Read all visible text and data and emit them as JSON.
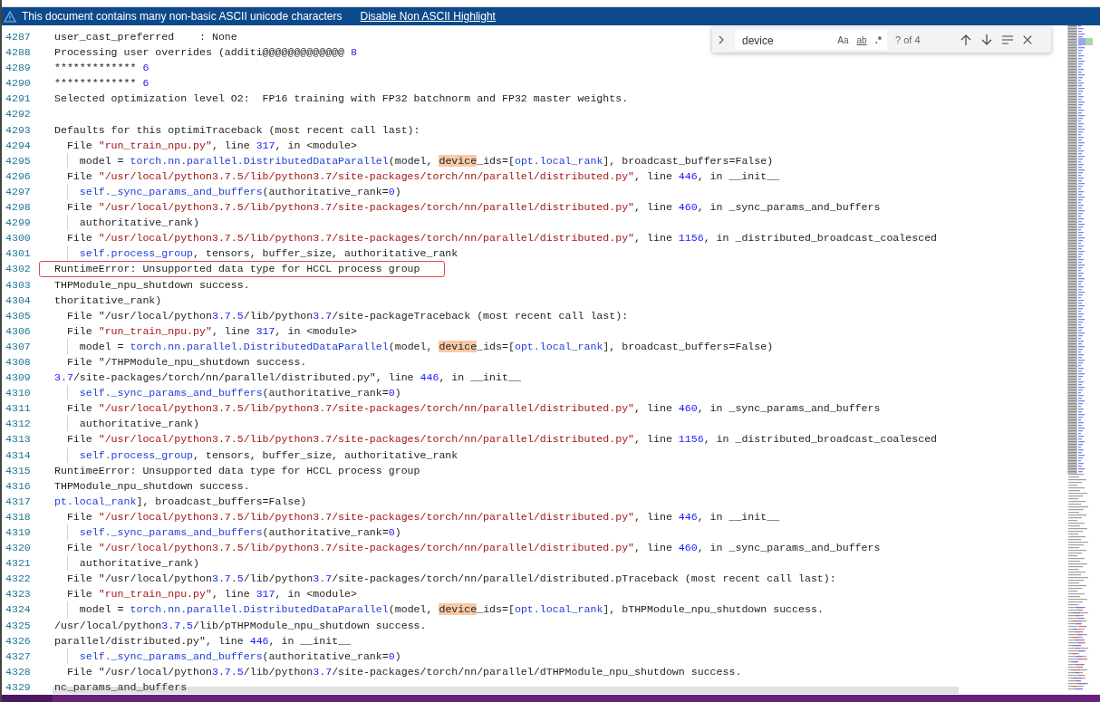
{
  "banner": {
    "message": "This document contains many non-basic ASCII unicode characters",
    "link": "Disable Non ASCII Highlight"
  },
  "find_widget": {
    "expanded": false,
    "query": "device",
    "options": [
      {
        "label": "Aa",
        "on": false
      },
      {
        "label": "ab",
        "on": false
      },
      {
        "label": ".*",
        "on": false
      }
    ],
    "match_count": "? of 4"
  },
  "lines": [
    {
      "number": "4287",
      "tokens": [
        {
          "kind": "text",
          "text": "user_cast_preferred    : None"
        }
      ]
    },
    {
      "number": "4288",
      "tokens": [
        {
          "kind": "text",
          "text": "Processing user overrides (additi@@@@@@@@@@@@@ "
        },
        {
          "kind": "number",
          "text": "8"
        }
      ]
    },
    {
      "number": "4289",
      "tokens": [
        {
          "kind": "text",
          "text": "************* "
        },
        {
          "kind": "number",
          "text": "6"
        }
      ]
    },
    {
      "number": "4290",
      "tokens": [
        {
          "kind": "text",
          "text": "************* "
        },
        {
          "kind": "number",
          "text": "6"
        }
      ]
    },
    {
      "number": "4291",
      "tokens": [
        {
          "kind": "text",
          "text": "Selected optimization level O2:  FP16 training with FP32 batchnorm and FP32 master weights."
        }
      ]
    },
    {
      "number": "4292"
    },
    {
      "number": "4293",
      "tokens": [
        {
          "kind": "text",
          "text": "Defaults for this optimiTraceback (most recent call last):"
        }
      ]
    },
    {
      "number": "4294",
      "tokens": [
        {
          "kind": "text",
          "text": "  File "
        },
        {
          "kind": "string",
          "text": "\"run_train_npu.py\""
        },
        {
          "kind": "text",
          "text": ", line "
        },
        {
          "kind": "number",
          "text": "317"
        },
        {
          "kind": "text",
          "text": ", in <module>"
        }
      ]
    },
    {
      "number": "4295",
      "tokens": [
        {
          "kind": "text",
          "text": "    model = "
        },
        {
          "kind": "name",
          "text": "torch.nn.parallel.DistributedDataParallel"
        },
        {
          "kind": "text",
          "text": "(model, "
        },
        {
          "kind": "match",
          "text": "device"
        },
        {
          "kind": "text",
          "text": "_ids=["
        },
        {
          "kind": "name",
          "text": "opt.local_rank"
        },
        {
          "kind": "text",
          "text": "], broadcast_buffers=False)"
        }
      ]
    },
    {
      "number": "4296",
      "tokens": [
        {
          "kind": "text",
          "text": "  File "
        },
        {
          "kind": "string",
          "text": "\"/usr/local/python3.7.5/lib/python3.7/site-packages/torch/nn/parallel/distributed.py\""
        },
        {
          "kind": "text",
          "text": ", line "
        },
        {
          "kind": "number",
          "text": "446"
        },
        {
          "kind": "text",
          "text": ", in __init__"
        }
      ]
    },
    {
      "number": "4297",
      "tokens": [
        {
          "kind": "name",
          "text": "    self._sync_params_and_buffers"
        },
        {
          "kind": "text",
          "text": "(authoritative_rank="
        },
        {
          "kind": "number",
          "text": "0"
        },
        {
          "kind": "text",
          "text": ")"
        }
      ]
    },
    {
      "number": "4298",
      "tokens": [
        {
          "kind": "text",
          "text": "  File "
        },
        {
          "kind": "string",
          "text": "\"/usr/local/python3.7.5/lib/python3.7/site-packages/torch/nn/parallel/distributed.py\""
        },
        {
          "kind": "text",
          "text": ", line "
        },
        {
          "kind": "number",
          "text": "460"
        },
        {
          "kind": "text",
          "text": ", in _sync_params_and_buffers"
        }
      ]
    },
    {
      "number": "4299",
      "tokens": [
        {
          "kind": "text",
          "text": "    authoritative_rank)"
        }
      ]
    },
    {
      "number": "4300",
      "tokens": [
        {
          "kind": "text",
          "text": "  File "
        },
        {
          "kind": "string",
          "text": "\"/usr/local/python3.7.5/lib/python3.7/site-packages/torch/nn/parallel/distributed.py\""
        },
        {
          "kind": "text",
          "text": ", line "
        },
        {
          "kind": "number",
          "text": "1156"
        },
        {
          "kind": "text",
          "text": ", in _distributed_broadcast_coalesced"
        }
      ]
    },
    {
      "number": "4301",
      "tokens": [
        {
          "kind": "name",
          "text": "    self.process_group"
        },
        {
          "kind": "text",
          "text": ", tensors, buffer_size, authoritative_rank"
        }
      ]
    },
    {
      "number": "4302",
      "boxed": true,
      "tokens": [
        {
          "kind": "text",
          "text": "RuntimeError: Unsupported data type for HCCL process group"
        }
      ]
    },
    {
      "number": "4303",
      "tokens": [
        {
          "kind": "text",
          "text": "THPModule_npu_shutdown success."
        }
      ]
    },
    {
      "number": "4304",
      "tokens": [
        {
          "kind": "text",
          "text": "thoritative_rank)"
        }
      ]
    },
    {
      "number": "4305",
      "tokens": [
        {
          "kind": "text",
          "text": "  File \"/usr/local/python"
        },
        {
          "kind": "number",
          "text": "3.7.5"
        },
        {
          "kind": "text",
          "text": "/lib/python"
        },
        {
          "kind": "number",
          "text": "3.7"
        },
        {
          "kind": "text",
          "text": "/site-packageTraceback (most recent call last):"
        }
      ]
    },
    {
      "number": "4306",
      "tokens": [
        {
          "kind": "text",
          "text": "  File "
        },
        {
          "kind": "string",
          "text": "\"run_train_npu.py\""
        },
        {
          "kind": "text",
          "text": ", line "
        },
        {
          "kind": "number",
          "text": "317"
        },
        {
          "kind": "text",
          "text": ", in <module>"
        }
      ]
    },
    {
      "number": "4307",
      "tokens": [
        {
          "kind": "text",
          "text": "    model = "
        },
        {
          "kind": "name",
          "text": "torch.nn.parallel.DistributedDataParallel"
        },
        {
          "kind": "text",
          "text": "(model, "
        },
        {
          "kind": "match",
          "text": "device"
        },
        {
          "kind": "text",
          "text": "_ids=["
        },
        {
          "kind": "name",
          "text": "opt.local_rank"
        },
        {
          "kind": "text",
          "text": "], broadcast_buffers=False)"
        }
      ]
    },
    {
      "number": "4308",
      "tokens": [
        {
          "kind": "text",
          "text": "  File \"/THPModule_npu_shutdown success."
        }
      ]
    },
    {
      "number": "4309",
      "tokens": [
        {
          "kind": "number",
          "text": "3.7"
        },
        {
          "kind": "text",
          "text": "/site-packages/torch/nn/parallel/distributed.py\", line "
        },
        {
          "kind": "number",
          "text": "446"
        },
        {
          "kind": "text",
          "text": ", in __init__"
        }
      ]
    },
    {
      "number": "4310",
      "tokens": [
        {
          "kind": "name",
          "text": "    self._sync_params_and_buffers"
        },
        {
          "kind": "text",
          "text": "(authoritative_rank="
        },
        {
          "kind": "number",
          "text": "0"
        },
        {
          "kind": "text",
          "text": ")"
        }
      ]
    },
    {
      "number": "4311",
      "tokens": [
        {
          "kind": "text",
          "text": "  File "
        },
        {
          "kind": "string",
          "text": "\"/usr/local/python3.7.5/lib/python3.7/site-packages/torch/nn/parallel/distributed.py\""
        },
        {
          "kind": "text",
          "text": ", line "
        },
        {
          "kind": "number",
          "text": "460"
        },
        {
          "kind": "text",
          "text": ", in _sync_params_and_buffers"
        }
      ]
    },
    {
      "number": "4312",
      "tokens": [
        {
          "kind": "text",
          "text": "    authoritative_rank)"
        }
      ]
    },
    {
      "number": "4313",
      "tokens": [
        {
          "kind": "text",
          "text": "  File "
        },
        {
          "kind": "string",
          "text": "\"/usr/local/python3.7.5/lib/python3.7/site-packages/torch/nn/parallel/distributed.py\""
        },
        {
          "kind": "text",
          "text": ", line "
        },
        {
          "kind": "number",
          "text": "1156"
        },
        {
          "kind": "text",
          "text": ", in _distributed_broadcast_coalesced"
        }
      ]
    },
    {
      "number": "4314",
      "tokens": [
        {
          "kind": "name",
          "text": "    self.process_group"
        },
        {
          "kind": "text",
          "text": ", tensors, buffer_size, authoritative_rank"
        }
      ]
    },
    {
      "number": "4315",
      "boxed": false,
      "tokens": [
        {
          "kind": "text",
          "text": "RuntimeError: Unsupported data type for HCCL process group"
        }
      ]
    },
    {
      "number": "4316",
      "tokens": [
        {
          "kind": "text",
          "text": "THPModule_npu_shutdown success."
        }
      ]
    },
    {
      "number": "4317",
      "tokens": [
        {
          "kind": "name",
          "text": "pt.local_rank"
        },
        {
          "kind": "text",
          "text": "], broadcast_buffers=False)"
        }
      ]
    },
    {
      "number": "4318",
      "tokens": [
        {
          "kind": "text",
          "text": "  File "
        },
        {
          "kind": "string",
          "text": "\"/usr/local/python3.7.5/lib/python3.7/site-packages/torch/nn/parallel/distributed.py\""
        },
        {
          "kind": "text",
          "text": ", line "
        },
        {
          "kind": "number",
          "text": "446"
        },
        {
          "kind": "text",
          "text": ", in __init__"
        }
      ]
    },
    {
      "number": "4319",
      "tokens": [
        {
          "kind": "name",
          "text": "    self._sync_params_and_buffers"
        },
        {
          "kind": "text",
          "text": "(authoritative_rank="
        },
        {
          "kind": "number",
          "text": "0"
        },
        {
          "kind": "text",
          "text": ")"
        }
      ]
    },
    {
      "number": "4320",
      "tokens": [
        {
          "kind": "text",
          "text": "  File "
        },
        {
          "kind": "string",
          "text": "\"/usr/local/python3.7.5/lib/python3.7/site-packages/torch/nn/parallel/distributed.py\""
        },
        {
          "kind": "text",
          "text": ", line "
        },
        {
          "kind": "number",
          "text": "460"
        },
        {
          "kind": "text",
          "text": ", in _sync_params_and_buffers"
        }
      ]
    },
    {
      "number": "4321",
      "tokens": [
        {
          "kind": "text",
          "text": "    authoritative_rank)"
        }
      ]
    },
    {
      "number": "4322",
      "tokens": [
        {
          "kind": "text",
          "text": "  File \"/usr/local/python"
        },
        {
          "kind": "number",
          "text": "3.7.5"
        },
        {
          "kind": "text",
          "text": "/lib/python"
        },
        {
          "kind": "number",
          "text": "3.7"
        },
        {
          "kind": "text",
          "text": "/site-packages/torch/nn/parallel/distributed.pTraceback (most recent call last):"
        }
      ]
    },
    {
      "number": "4323",
      "tokens": [
        {
          "kind": "text",
          "text": "  File "
        },
        {
          "kind": "string",
          "text": "\"run_train_npu.py\""
        },
        {
          "kind": "text",
          "text": ", line "
        },
        {
          "kind": "number",
          "text": "317"
        },
        {
          "kind": "text",
          "text": ", in <module>"
        }
      ]
    },
    {
      "number": "4324",
      "tokens": [
        {
          "kind": "text",
          "text": "    model = "
        },
        {
          "kind": "name",
          "text": "torch.nn.parallel.DistributedDataParallel"
        },
        {
          "kind": "text",
          "text": "(model, "
        },
        {
          "kind": "match",
          "text": "device"
        },
        {
          "kind": "text",
          "text": "_ids=["
        },
        {
          "kind": "name",
          "text": "opt.local_rank"
        },
        {
          "kind": "text",
          "text": "], bTHPModule_npu_shutdown success."
        }
      ]
    },
    {
      "number": "4325",
      "tokens": [
        {
          "kind": "text",
          "text": "/usr/local/python"
        },
        {
          "kind": "number",
          "text": "3.7.5"
        },
        {
          "kind": "text",
          "text": "/lib/pTHPModule_npu_shutdown success."
        }
      ]
    },
    {
      "number": "4326",
      "tokens": [
        {
          "kind": "text",
          "text": "parallel/distributed.py\", line "
        },
        {
          "kind": "number",
          "text": "446"
        },
        {
          "kind": "text",
          "text": ", in __init__"
        }
      ]
    },
    {
      "number": "4327",
      "tokens": [
        {
          "kind": "name",
          "text": "    self._sync_params_and_buffers"
        },
        {
          "kind": "text",
          "text": "(authoritative_rank="
        },
        {
          "kind": "number",
          "text": "0"
        },
        {
          "kind": "text",
          "text": ")"
        }
      ]
    },
    {
      "number": "4328",
      "tokens": [
        {
          "kind": "text",
          "text": "  File \"/usr/local/python"
        },
        {
          "kind": "number",
          "text": "3.7.5"
        },
        {
          "kind": "text",
          "text": "/lib/python"
        },
        {
          "kind": "number",
          "text": "3.7"
        },
        {
          "kind": "text",
          "text": "/site-packages/torch/nn/parallel/dTHPModule_npu_shutdown success."
        }
      ]
    },
    {
      "number": "4329",
      "tokens": [
        {
          "kind": "text",
          "text": "nc_params_and_buffers"
        }
      ]
    }
  ]
}
